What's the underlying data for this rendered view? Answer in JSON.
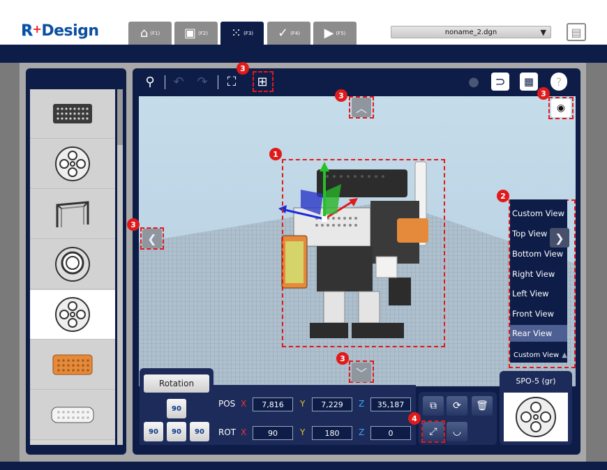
{
  "app": {
    "logo_prefix": "R",
    "logo_plus": "+",
    "logo_suffix": "Design"
  },
  "tabs": [
    {
      "key": "(F1)",
      "icon": "home-icon"
    },
    {
      "key": "(F2)",
      "icon": "robot-icon"
    },
    {
      "key": "(F3)",
      "icon": "assembly-icon",
      "active": true
    },
    {
      "key": "(F4)",
      "icon": "check-icon"
    },
    {
      "key": "(F5)",
      "icon": "video-icon"
    }
  ],
  "file": {
    "name": "noname_2.dgn"
  },
  "callouts": {
    "c1": "1",
    "c2": "2",
    "c3": "3",
    "c4": "4"
  },
  "view_menu": {
    "items": [
      "Custom View",
      "Top View",
      "Bottom View",
      "Right View",
      "Left View",
      "Front View",
      "Rear View"
    ],
    "selected": "Rear View",
    "footer": "Custom View"
  },
  "rotation": {
    "label": "Rotation",
    "angle": "90"
  },
  "pos": {
    "label": "POS",
    "x": "7,816",
    "y": "7,229",
    "z": "35,187"
  },
  "rot": {
    "label": "ROT",
    "x": "90",
    "y": "180",
    "z": "0"
  },
  "axes": {
    "x": "X",
    "y": "Y",
    "z": "Z"
  },
  "selected_part": {
    "name": "SPO-5 (gr)"
  },
  "colors": {
    "navy": "#0e1d48",
    "callout": "#e01a1a",
    "orange": "#e58a3a"
  }
}
